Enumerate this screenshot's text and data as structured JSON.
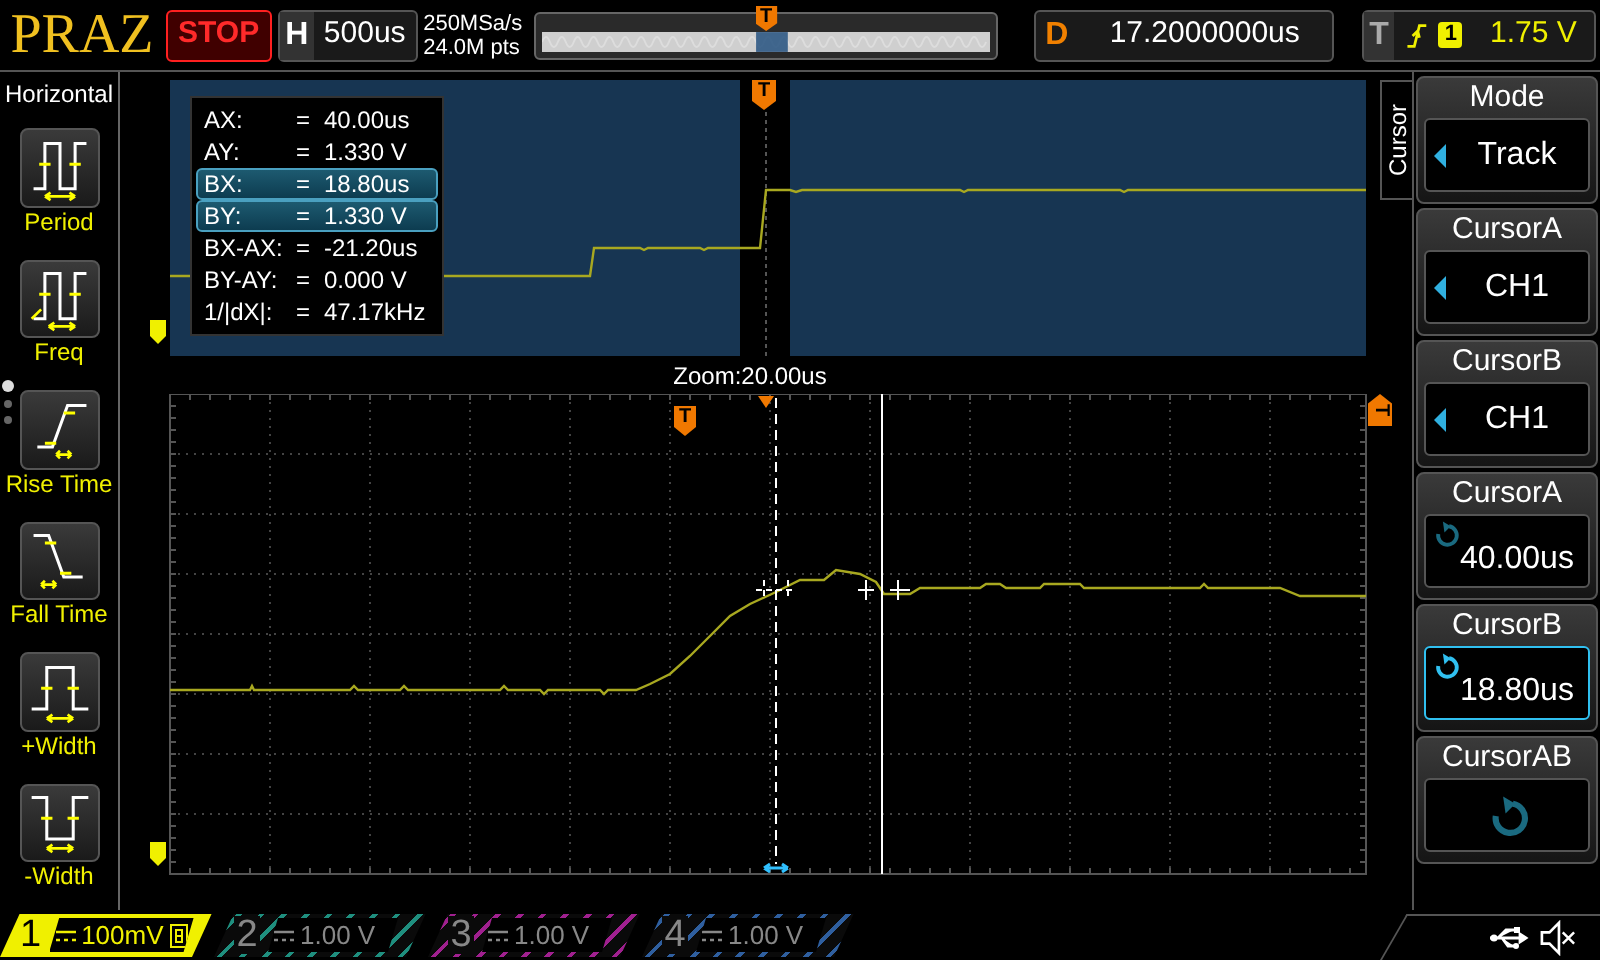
{
  "logo": "PRAZ",
  "run_state": {
    "label": "STOP"
  },
  "timebase": {
    "label": "H",
    "value": "500us"
  },
  "acquisition": {
    "sample_rate": "250MSa/s",
    "memory_depth": "24.0M pts"
  },
  "memory_strip": {
    "marker": "T"
  },
  "delay": {
    "label": "D",
    "value": "17.2000000us"
  },
  "trigger": {
    "label": "T",
    "channel": "1",
    "level": "1.75 V"
  },
  "horizontal_menu": {
    "title": "Horizontal",
    "page_dots": [
      {
        "selected": true
      },
      {
        "selected": false
      },
      {
        "selected": false
      }
    ],
    "items": [
      {
        "kind": "period",
        "label": "Period"
      },
      {
        "kind": "freq",
        "label": "Freq"
      },
      {
        "kind": "rise",
        "label": "Rise Time"
      },
      {
        "kind": "fall",
        "label": "Fall Time"
      },
      {
        "kind": "pwidth",
        "label": "+Width"
      },
      {
        "kind": "nwidth",
        "label": "-Width"
      }
    ]
  },
  "overview": {
    "trigger_marker": "T"
  },
  "cursor_table": {
    "rows": [
      {
        "name": "AX:",
        "sign": "=",
        "value": "40.00us",
        "selected": false
      },
      {
        "name": "AY:",
        "sign": "=",
        "value": "1.330 V",
        "selected": false
      },
      {
        "name": "BX:",
        "sign": "=",
        "value": "18.80us",
        "selected": true
      },
      {
        "name": "BY:",
        "sign": "=",
        "value": "1.330 V",
        "selected": true
      },
      {
        "name": "BX-AX:",
        "sign": "=",
        "value": "-21.20us",
        "selected": false
      },
      {
        "name": "BY-AY:",
        "sign": "=",
        "value": "0.000 V",
        "selected": false
      },
      {
        "name": "1/|dX|:",
        "sign": "=",
        "value": "47.17kHz",
        "selected": false
      }
    ]
  },
  "zoom_label": "Zoom:20.00us",
  "grid": {
    "trigger_marker": "T",
    "level_marker": "T"
  },
  "cursor_menu": {
    "tab": "Cursor",
    "softkeys": [
      {
        "kind": "select",
        "title": "Mode",
        "value": "Track",
        "selected": false
      },
      {
        "kind": "select",
        "title": "CursorA",
        "value": "CH1",
        "selected": false
      },
      {
        "kind": "select",
        "title": "CursorB",
        "value": "CH1",
        "selected": false
      },
      {
        "kind": "knob",
        "title": "CursorA",
        "value": "40.00us",
        "selected": false
      },
      {
        "kind": "knob",
        "title": "CursorB",
        "value": "18.80us",
        "selected": true
      },
      {
        "kind": "knob",
        "title": "CursorAB",
        "selected": false
      }
    ]
  },
  "channels": [
    {
      "number": "1",
      "scale": "100mV",
      "on": true,
      "color": "#f0f000"
    },
    {
      "number": "2",
      "scale": "1.00 V",
      "on": false,
      "color": "#1f8f7f"
    },
    {
      "number": "3",
      "scale": "1.00 V",
      "on": false,
      "color": "#a0208f"
    },
    {
      "number": "4",
      "scale": "1.00 V",
      "on": false,
      "color": "#2f5f9f"
    }
  ]
}
